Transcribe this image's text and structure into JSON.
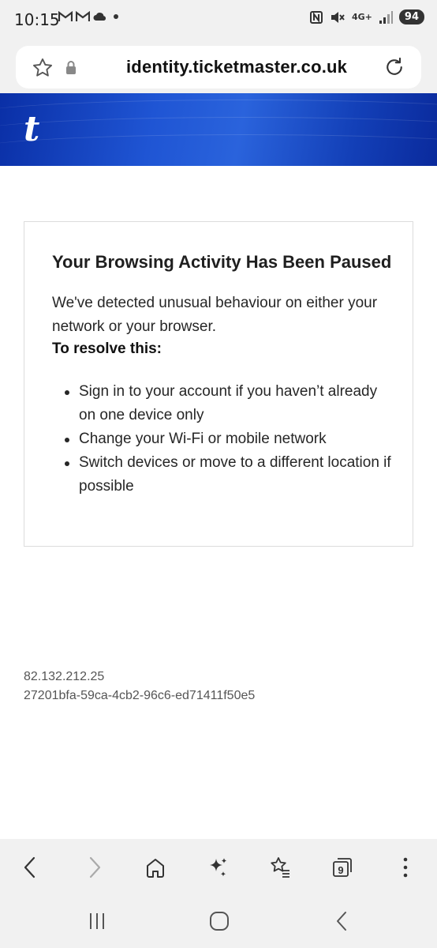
{
  "status_bar": {
    "time": "10:15",
    "network": "4G+",
    "battery": "94",
    "icons": [
      "gmail-icon",
      "gmail-icon",
      "cloud-icon",
      "dot-icon",
      "nfc-icon",
      "mute-icon",
      "signal-icon"
    ]
  },
  "address_bar": {
    "url": "identity.ticketmaster.co.uk"
  },
  "header": {
    "logo": "t",
    "color_dark": "#0a2fa6",
    "color_light": "#2a63dc"
  },
  "card": {
    "title": "Your Browsing Activity Has Been Paused",
    "description": "We've detected unusual behaviour on either your network or your browser.",
    "resolve_label": "To resolve this:",
    "steps": [
      "Sign in to your account if you haven’t already on one device only",
      "Change your Wi-Fi or mobile network",
      "Switch devices or move to a different location if possible"
    ]
  },
  "diagnostics": {
    "ip": "82.132.212.25",
    "reference": "27201bfa-59ca-4cb2-96c6-ed71411f50e5"
  },
  "toolbar": {
    "tab_count": "9",
    "icons": [
      "back-icon",
      "forward-icon",
      "home-icon",
      "sparkle-icon",
      "bookmarks-icon",
      "tabs-icon",
      "more-icon"
    ]
  },
  "nav_bar": {
    "icons": [
      "recents-icon",
      "home-nav-icon",
      "back-nav-icon"
    ]
  }
}
